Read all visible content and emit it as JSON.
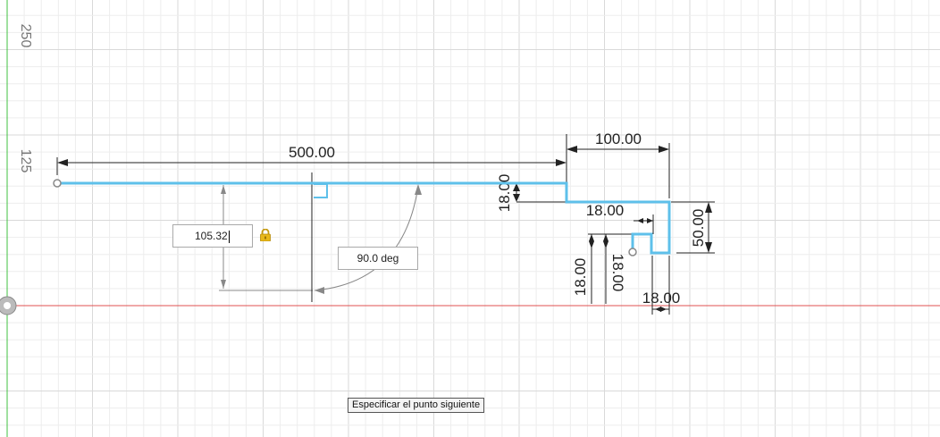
{
  "axes": {
    "y_label_250": "250",
    "y_label_125": "125"
  },
  "dimensions": {
    "overall_length": "500.00",
    "right_width": "100.00",
    "step_height": "18.00",
    "inner_width": "18.00",
    "right_height": "50.00",
    "lower_vertical_left": "18.00",
    "lower_vertical_right": "18.00",
    "bottom_width": "18.00"
  },
  "input": {
    "value": "105.32"
  },
  "angle": {
    "value": "90.0 deg"
  },
  "status": {
    "prompt": "Especificar el punto siguiente"
  },
  "colors": {
    "sketch": "#5ec0ea",
    "x_axis": "#e04040",
    "y_axis": "#40c040",
    "grid": "#e6e6e6"
  },
  "icons": {
    "lock": "lock-icon",
    "origin": "origin-icon"
  }
}
